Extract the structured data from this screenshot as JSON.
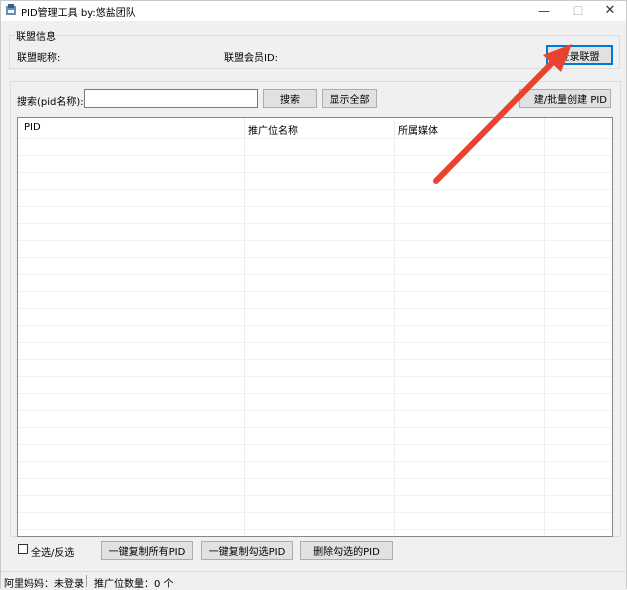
{
  "window": {
    "title": "PID管理工具  by:悠盐团队",
    "minimize_glyph": "—",
    "maximize_glyph": "☐",
    "close_glyph": "✕"
  },
  "alliance": {
    "group_title": "联盟信息",
    "nickname_label": "联盟昵称:",
    "member_id_label": "联盟会员ID:",
    "login_button": "登录联盟"
  },
  "search": {
    "label": "搜索(pid名称):",
    "value": "",
    "search_button": "搜索",
    "show_all_button": "显示全部",
    "batch_create_button": "建/批量创建 PID"
  },
  "table": {
    "columns": [
      "PID",
      "推广位名称",
      "所属媒体",
      ""
    ],
    "rows": []
  },
  "bottom": {
    "select_all_label": "全选/反选",
    "copy_all_button": "一键复制所有PID",
    "copy_selected_button": "一键复制勾选PID",
    "delete_selected_button": "删除勾选的PID"
  },
  "status": {
    "login_status": "阿里妈妈：未登录",
    "pid_count": "推广位数量：0 个"
  },
  "colors": {
    "arrow": "#e8432e",
    "primary_border": "#0078d7"
  }
}
